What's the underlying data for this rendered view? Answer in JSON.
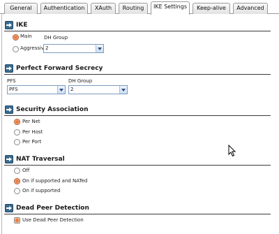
{
  "tabs": [
    {
      "label": "General"
    },
    {
      "label": "Authentication"
    },
    {
      "label": "XAuth"
    },
    {
      "label": "Routing"
    },
    {
      "label": "IKE Settings",
      "active": true
    },
    {
      "label": "Keep-alive"
    },
    {
      "label": "Advanced"
    }
  ],
  "ike": {
    "title": "IKE",
    "main_label": "Main",
    "aggressive_label": "Aggressive",
    "dh_group_label": "DH Group",
    "dh_group_value": "2",
    "selected_mode": "Main"
  },
  "pfs_section": {
    "title": "Perfect Forward Secrecy",
    "pfs_label": "PFS",
    "pfs_value": "PFS",
    "dh_group_label": "DH Group",
    "dh_group_value": "2"
  },
  "security_association": {
    "title": "Security Association",
    "options": [
      "Per Net",
      "Per Host",
      "Per Port"
    ],
    "selected": "Per Net"
  },
  "nat_traversal": {
    "title": "NAT Traversal",
    "options": [
      "Off",
      "On if supported and NATed",
      "On if supported"
    ],
    "selected": "On if supported and NATed"
  },
  "dpd": {
    "title": "Dead Peer Detection",
    "checkbox_label": "Use Dead Peer Detection",
    "checked": true
  },
  "colors": {
    "section_icon": "#3c6c8e",
    "radio_selected": "#e97c43",
    "select_border": "#7d9cc0"
  }
}
